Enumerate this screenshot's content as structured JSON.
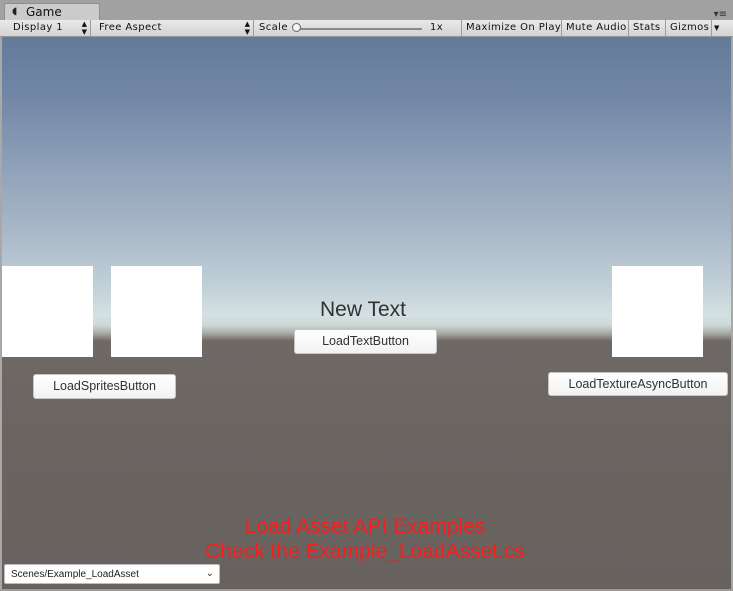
{
  "tab": {
    "title": "Game",
    "icon": "pacman-icon"
  },
  "toolbar": {
    "display": "Display 1",
    "aspect": "Free Aspect",
    "scale_label": "Scale",
    "scale_value": "1x",
    "scale_level": 0,
    "maximize": "Maximize On Play",
    "mute": "Mute Audio",
    "stats": "Stats",
    "gizmos": "Gizmos"
  },
  "game": {
    "new_text": "New Text",
    "load_text_button": "LoadTextButton",
    "load_sprites_button": "LoadSpritesButton",
    "load_texture_async_button": "LoadTextureAsyncButton",
    "info_line1": "Load Asset API Examples",
    "info_line2": "Check the Example_LoadAsset.cs",
    "scene_dropdown": "Scenes/Example_LoadAsset"
  },
  "colors": {
    "info_text": "#ff1a1a",
    "sky_top": "#647a99",
    "ground": "#6b6562"
  }
}
